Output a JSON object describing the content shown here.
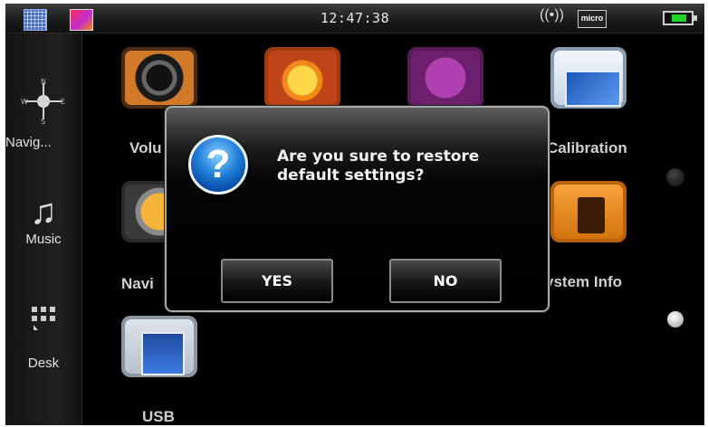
{
  "status_bar": {
    "time": "12:47:38",
    "icons": [
      "calendar-icon",
      "photo-icon",
      "wireless-icon",
      "sd-card-icon",
      "battery-icon"
    ],
    "card_label": "micro SD"
  },
  "sidebar": {
    "items": [
      {
        "label": "Navig...",
        "icon": "compass-icon"
      },
      {
        "label": "Music",
        "icon": "music-note-icon"
      },
      {
        "label": "Desk",
        "icon": "grid-icon"
      }
    ]
  },
  "apps": {
    "volume": "Volu",
    "calibration": "Calibration",
    "navi": "Navi",
    "system_info": "ystem Info",
    "usb": "USB"
  },
  "dialog": {
    "message": "Are you sure to restore default settings?",
    "icon": "question-icon",
    "yes_label": "YES",
    "no_label": "NO"
  },
  "colors": {
    "dialog_border": "#a9a9a9",
    "question_icon": "#1f7ed8",
    "battery_fill": "#22d32a"
  }
}
